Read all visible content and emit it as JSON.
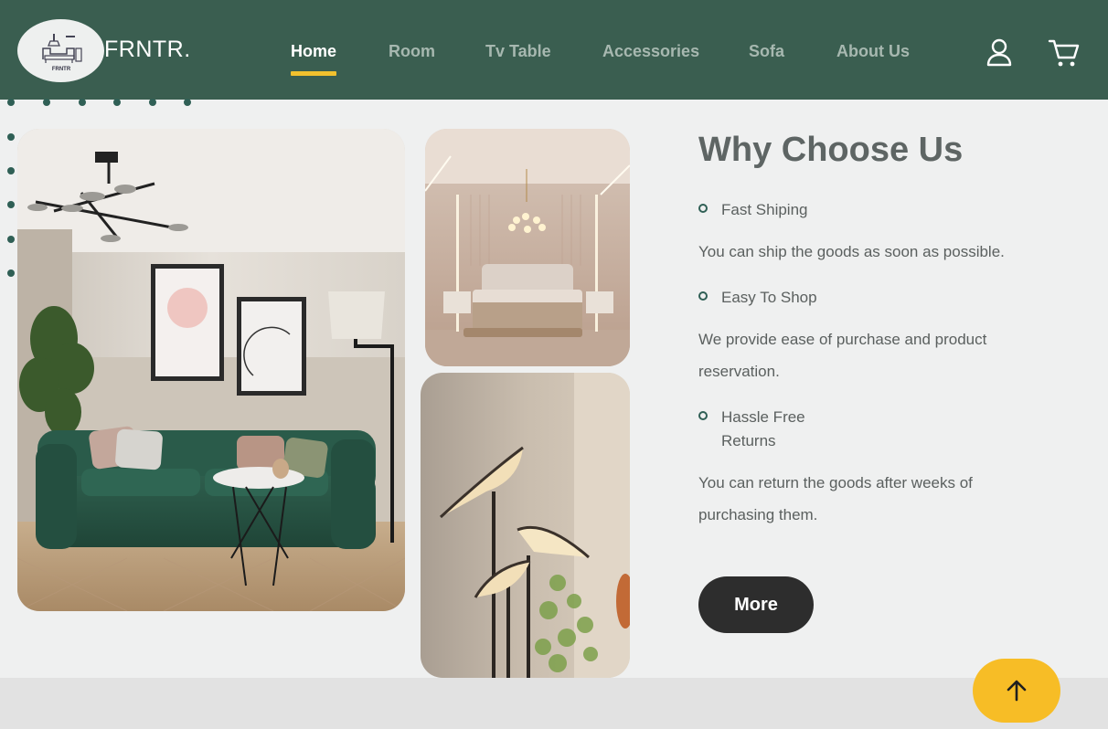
{
  "brand": {
    "name": "FRNTR.",
    "logo_caption": "FRNTR"
  },
  "nav": {
    "items": [
      {
        "label": "Home",
        "active": true
      },
      {
        "label": "Room"
      },
      {
        "label": "Tv Table"
      },
      {
        "label": "Accessories"
      },
      {
        "label": "Sofa"
      },
      {
        "label": "About Us"
      }
    ]
  },
  "header_icons": {
    "account": "user-icon",
    "cart": "shopping-cart-icon"
  },
  "section": {
    "title": "Why Choose Us",
    "features": [
      {
        "label_line1": "Fast Shiping",
        "label_line2": "",
        "description": "You can ship the goods as soon as possible."
      },
      {
        "label_line1": "Easy To Shop",
        "label_line2": "",
        "description": "We provide ease of purchase and product reservation."
      },
      {
        "label_line1": "Hassle Free",
        "label_line2": "Returns",
        "description": "You can return the goods after weeks of purchasing them."
      }
    ],
    "more_button": "More"
  },
  "images": [
    {
      "name": "living-room-photo"
    },
    {
      "name": "bedroom-photo"
    },
    {
      "name": "bird-lamps-photo"
    }
  ],
  "colors": {
    "header_bg": "#3a5e50",
    "accent_yellow": "#f2c12e",
    "button_dark": "#2d2d2d",
    "scroll_top": "#f7bd26"
  },
  "scroll_top_icon": "arrow-up-icon"
}
